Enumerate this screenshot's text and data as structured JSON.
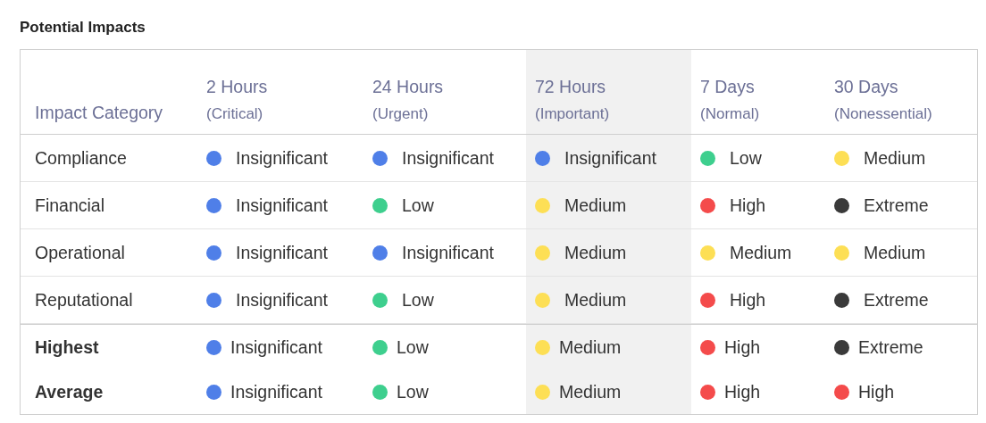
{
  "title": "Potential Impacts",
  "table": {
    "columns": [
      {
        "label": "Impact Category",
        "highlighted": false
      },
      {
        "label": "2 Hours",
        "sublabel": "(Critical)",
        "highlighted": false
      },
      {
        "label": "24 Hours",
        "sublabel": "(Urgent)",
        "highlighted": false
      },
      {
        "label": "72 Hours",
        "sublabel": "(Important)",
        "highlighted": true
      },
      {
        "label": "7 Days",
        "sublabel": "(Normal)",
        "highlighted": false
      },
      {
        "label": "30 Days",
        "sublabel": "(Nonessential)",
        "highlighted": false
      }
    ],
    "rows": [
      {
        "kind": "category",
        "cells": [
          {
            "text": "Compliance"
          },
          {
            "text": "Insignificant",
            "color": "#4f7fe8"
          },
          {
            "text": "Insignificant",
            "color": "#4f7fe8"
          },
          {
            "text": "Insignificant",
            "color": "#4f7fe8"
          },
          {
            "text": "Low",
            "color": "#3ecf8e"
          },
          {
            "text": "Medium",
            "color": "#fddf55"
          }
        ]
      },
      {
        "kind": "category",
        "cells": [
          {
            "text": "Financial"
          },
          {
            "text": "Insignificant",
            "color": "#4f7fe8"
          },
          {
            "text": "Low",
            "color": "#3ecf8e"
          },
          {
            "text": "Medium",
            "color": "#fddf55"
          },
          {
            "text": "High",
            "color": "#f44b4b"
          },
          {
            "text": "Extreme",
            "color": "#3a3a3a"
          }
        ]
      },
      {
        "kind": "category",
        "cells": [
          {
            "text": "Operational"
          },
          {
            "text": "Insignificant",
            "color": "#4f7fe8"
          },
          {
            "text": "Insignificant",
            "color": "#4f7fe8"
          },
          {
            "text": "Medium",
            "color": "#fddf55"
          },
          {
            "text": "Medium",
            "color": "#fddf55"
          },
          {
            "text": "Medium",
            "color": "#fddf55"
          }
        ]
      },
      {
        "kind": "category",
        "cells": [
          {
            "text": "Reputational"
          },
          {
            "text": "Insignificant",
            "color": "#4f7fe8"
          },
          {
            "text": "Low",
            "color": "#3ecf8e"
          },
          {
            "text": "Medium",
            "color": "#fddf55"
          },
          {
            "text": "High",
            "color": "#f44b4b"
          },
          {
            "text": "Extreme",
            "color": "#3a3a3a"
          }
        ]
      },
      {
        "kind": "summary",
        "cells": [
          {
            "text": "Highest"
          },
          {
            "text": "Insignificant",
            "color": "#4f7fe8"
          },
          {
            "text": "Low",
            "color": "#3ecf8e"
          },
          {
            "text": "Medium",
            "color": "#fddf55"
          },
          {
            "text": "High",
            "color": "#f44b4b"
          },
          {
            "text": "Extreme",
            "color": "#3a3a3a"
          }
        ]
      },
      {
        "kind": "summary",
        "cells": [
          {
            "text": "Average"
          },
          {
            "text": "Insignificant",
            "color": "#4f7fe8"
          },
          {
            "text": "Low",
            "color": "#3ecf8e"
          },
          {
            "text": "Medium",
            "color": "#fddf55"
          },
          {
            "text": "High",
            "color": "#f44b4b"
          },
          {
            "text": "High",
            "color": "#f44b4b"
          }
        ]
      }
    ]
  }
}
